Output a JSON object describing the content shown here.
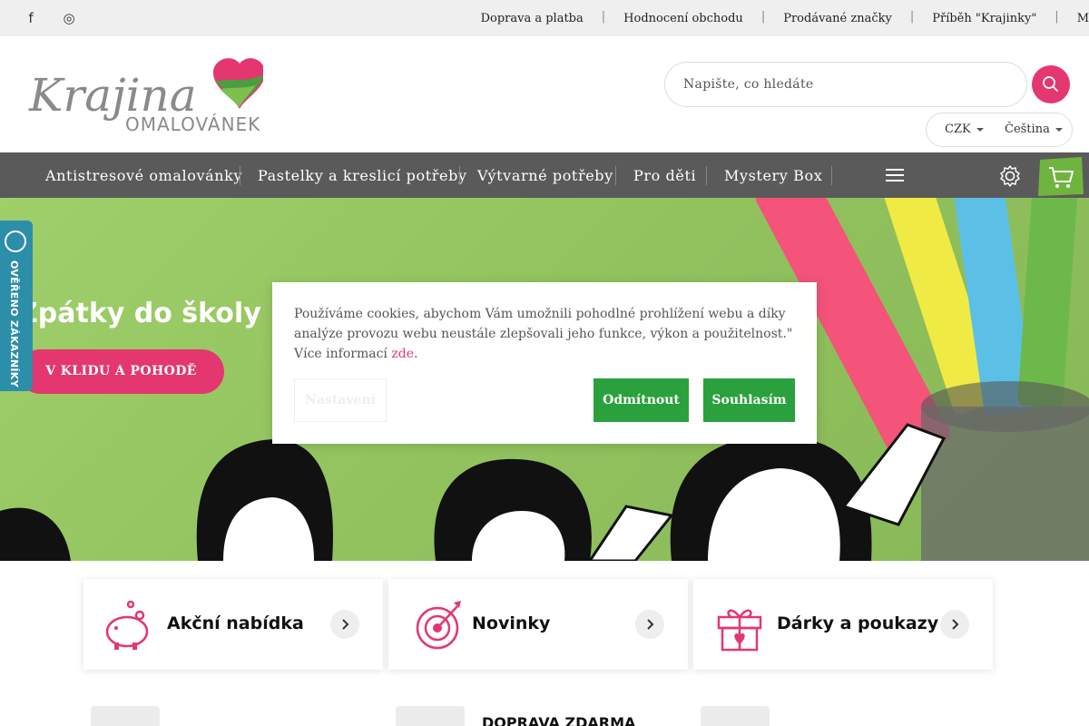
{
  "topbar": {
    "icons": [
      "facebook-icon",
      "instagram-icon"
    ],
    "links": [
      "Doprava a platba",
      "Hodnocení obchodu",
      "Prodávané značky",
      "Příběh \"Krajinky\"",
      "M"
    ]
  },
  "logo": {
    "script": "Krajina",
    "sub": "OMALOVÁNEK"
  },
  "search": {
    "placeholder": "Napište, co hledáte"
  },
  "settings": {
    "currency": "CZK",
    "language": "Čeština"
  },
  "nav": {
    "items": [
      "Antistresové omalovánky",
      "Pastelky a kreslicí potřeby",
      "Výtvarné potřeby",
      "Pro děti",
      "Mystery Box"
    ]
  },
  "hero": {
    "title": "Zpátky do školy",
    "cta": "V KLIDU A POHODĚ"
  },
  "badge": {
    "text": "OVĚŘENO ZÁKAZNÍKY"
  },
  "cookie": {
    "text": "Používáme cookies, abychom Vám umožnili pohodlné prohlížení webu a díky analýze provozu webu neustále zlepšovali jeho funkce, výkon a použitelnost.\" Více informací ",
    "link": "zde",
    "after": ".",
    "settings": "Nastavení",
    "decline": "Odmítnout",
    "accept": "Souhlasím"
  },
  "cards": [
    {
      "label": "Akční nabídka",
      "icon": "piggy-bank-icon"
    },
    {
      "label": "Novinky",
      "icon": "target-icon"
    },
    {
      "label": "Dárky a poukazy",
      "icon": "gift-icon"
    }
  ],
  "bottom": {
    "title": "DOPRAVA ZDARMA"
  },
  "colors": {
    "accent": "#e4376f",
    "nav": "#5a5a5a",
    "green": "#2aa13c",
    "hero": "#93c35f",
    "badge": "#2c8ea8"
  }
}
